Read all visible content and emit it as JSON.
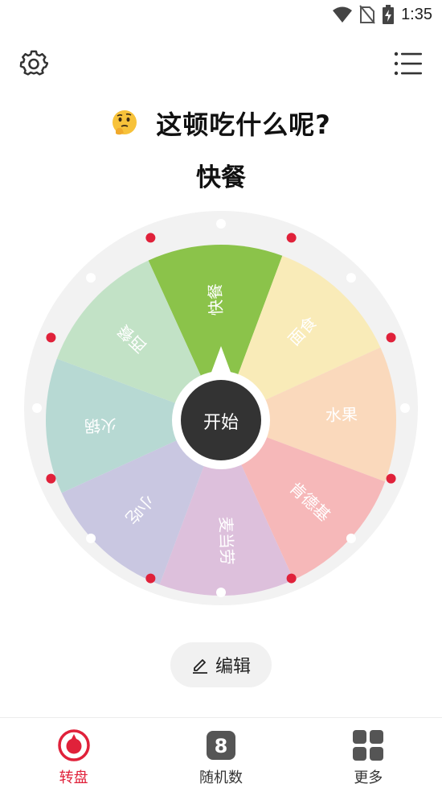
{
  "status_bar": {
    "time": "1:35"
  },
  "header": {
    "question": "这顿吃什么呢?"
  },
  "result": {
    "label": "快餐"
  },
  "wheel": {
    "segments": [
      {
        "label": "快餐",
        "color": "#8BC34A"
      },
      {
        "label": "面食",
        "color": "#F9EBB8"
      },
      {
        "label": "水果",
        "color": "#FAD9BC"
      },
      {
        "label": "肯德基",
        "color": "#F6B8B9"
      },
      {
        "label": "麦当劳",
        "color": "#DDC0DC"
      },
      {
        "label": "小吃",
        "color": "#C9C7E1"
      },
      {
        "label": "火锅",
        "color": "#B7D9D3"
      },
      {
        "label": "西餐",
        "color": "#C2E2C6"
      }
    ],
    "start_label": "开始",
    "hub_color": "#333333",
    "rim_color": "#F2F2F2",
    "dot_red": "#E0213A"
  },
  "edit": {
    "label": "编辑"
  },
  "nav": {
    "accent": "#E0213A",
    "items": [
      {
        "label": "转盘",
        "icon": "wheel-icon"
      },
      {
        "label": "随机数",
        "icon": "dice-icon"
      },
      {
        "label": "更多",
        "icon": "grid-icon"
      }
    ]
  }
}
